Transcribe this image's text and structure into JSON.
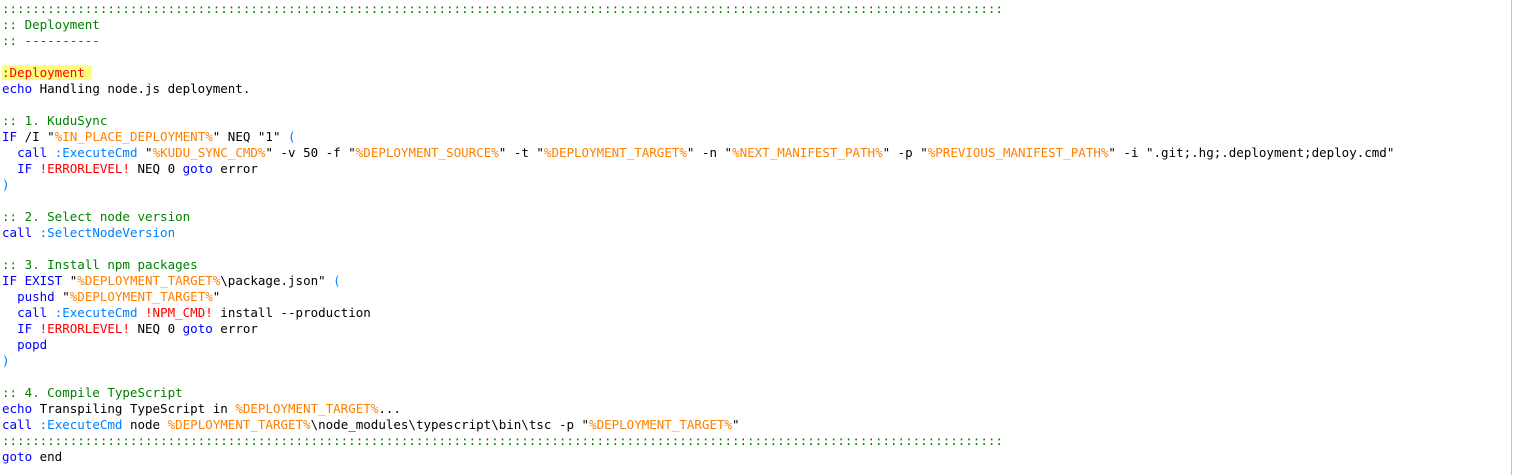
{
  "colors": {
    "comment": "#008000",
    "keyword": "#0000ff",
    "label_fg": "#ff0000",
    "label_bg": "#ffff80",
    "variable": "#ff8000",
    "delayed_variable": "#ff0000",
    "call_target": "#0080ff",
    "text": "#000000"
  },
  "lines": [
    [
      {
        "t": "cmt",
        "v": ":::::::::::::::::::::::::::::::::::::::::::::::::::::::::::::::::::::::::::::::::::::::::::::::::::::::::::::::::::::::::::::::::::::"
      }
    ],
    [
      {
        "t": "cmt",
        "v": ":: Deployment"
      }
    ],
    [
      {
        "t": "cmt",
        "v": ":: ----------"
      }
    ],
    [],
    [
      {
        "t": "lbl",
        "v": ":Deployment "
      }
    ],
    [
      {
        "t": "kw",
        "v": "echo"
      },
      {
        "t": "plain",
        "v": " Handling node.js deployment."
      }
    ],
    [],
    [
      {
        "t": "cmt",
        "v": ":: 1. KuduSync"
      }
    ],
    [
      {
        "t": "kw",
        "v": "IF"
      },
      {
        "t": "plain",
        "v": " /I \""
      },
      {
        "t": "var",
        "v": "%IN_PLACE_DEPLOYMENT%"
      },
      {
        "t": "plain",
        "v": "\" NEQ \"1\" "
      },
      {
        "t": "par",
        "v": "("
      }
    ],
    [
      {
        "t": "plain",
        "v": "  "
      },
      {
        "t": "kw",
        "v": "call"
      },
      {
        "t": "plain",
        "v": " "
      },
      {
        "t": "call",
        "v": ":ExecuteCmd"
      },
      {
        "t": "plain",
        "v": " \""
      },
      {
        "t": "var",
        "v": "%KUDU_SYNC_CMD%"
      },
      {
        "t": "plain",
        "v": "\" -v 50 -f \""
      },
      {
        "t": "var",
        "v": "%DEPLOYMENT_SOURCE%"
      },
      {
        "t": "plain",
        "v": "\" -t \""
      },
      {
        "t": "var",
        "v": "%DEPLOYMENT_TARGET%"
      },
      {
        "t": "plain",
        "v": "\" -n \""
      },
      {
        "t": "var",
        "v": "%NEXT_MANIFEST_PATH%"
      },
      {
        "t": "plain",
        "v": "\" -p \""
      },
      {
        "t": "var",
        "v": "%PREVIOUS_MANIFEST_PATH%"
      },
      {
        "t": "plain",
        "v": "\" -i \".git;.hg;.deployment;deploy.cmd\""
      }
    ],
    [
      {
        "t": "plain",
        "v": "  "
      },
      {
        "t": "kw",
        "v": "IF"
      },
      {
        "t": "plain",
        "v": " "
      },
      {
        "t": "dvar",
        "v": "!ERRORLEVEL!"
      },
      {
        "t": "plain",
        "v": " NEQ 0 "
      },
      {
        "t": "kw",
        "v": "goto"
      },
      {
        "t": "plain",
        "v": " error"
      }
    ],
    [
      {
        "t": "par",
        "v": ")"
      }
    ],
    [],
    [
      {
        "t": "cmt",
        "v": ":: 2. Select node version"
      }
    ],
    [
      {
        "t": "kw",
        "v": "call"
      },
      {
        "t": "plain",
        "v": " "
      },
      {
        "t": "call",
        "v": ":SelectNodeVersion"
      }
    ],
    [],
    [
      {
        "t": "cmt",
        "v": ":: 3. Install npm packages"
      }
    ],
    [
      {
        "t": "kw",
        "v": "IF EXIST"
      },
      {
        "t": "plain",
        "v": " \""
      },
      {
        "t": "var",
        "v": "%DEPLOYMENT_TARGET%"
      },
      {
        "t": "plain",
        "v": "\\package.json\" "
      },
      {
        "t": "par",
        "v": "("
      }
    ],
    [
      {
        "t": "plain",
        "v": "  "
      },
      {
        "t": "kw",
        "v": "pushd"
      },
      {
        "t": "plain",
        "v": " \""
      },
      {
        "t": "var",
        "v": "%DEPLOYMENT_TARGET%"
      },
      {
        "t": "plain",
        "v": "\""
      }
    ],
    [
      {
        "t": "plain",
        "v": "  "
      },
      {
        "t": "kw",
        "v": "call"
      },
      {
        "t": "plain",
        "v": " "
      },
      {
        "t": "call",
        "v": ":ExecuteCmd"
      },
      {
        "t": "plain",
        "v": " "
      },
      {
        "t": "dvar",
        "v": "!NPM_CMD!"
      },
      {
        "t": "plain",
        "v": " install --production"
      }
    ],
    [
      {
        "t": "plain",
        "v": "  "
      },
      {
        "t": "kw",
        "v": "IF"
      },
      {
        "t": "plain",
        "v": " "
      },
      {
        "t": "dvar",
        "v": "!ERRORLEVEL!"
      },
      {
        "t": "plain",
        "v": " NEQ 0 "
      },
      {
        "t": "kw",
        "v": "goto"
      },
      {
        "t": "plain",
        "v": " error"
      }
    ],
    [
      {
        "t": "plain",
        "v": "  "
      },
      {
        "t": "kw",
        "v": "popd"
      }
    ],
    [
      {
        "t": "par",
        "v": ")"
      }
    ],
    [],
    [
      {
        "t": "cmt",
        "v": ":: 4. Compile TypeScript"
      }
    ],
    [
      {
        "t": "kw",
        "v": "echo"
      },
      {
        "t": "plain",
        "v": " Transpiling TypeScript in "
      },
      {
        "t": "var",
        "v": "%DEPLOYMENT_TARGET%"
      },
      {
        "t": "plain",
        "v": "..."
      }
    ],
    [
      {
        "t": "kw",
        "v": "call"
      },
      {
        "t": "plain",
        "v": " "
      },
      {
        "t": "call",
        "v": ":ExecuteCmd"
      },
      {
        "t": "plain",
        "v": " node "
      },
      {
        "t": "var",
        "v": "%DEPLOYMENT_TARGET%"
      },
      {
        "t": "plain",
        "v": "\\node_modules\\typescript\\bin\\tsc -p \""
      },
      {
        "t": "var",
        "v": "%DEPLOYMENT_TARGET%"
      },
      {
        "t": "plain",
        "v": "\""
      }
    ],
    [
      {
        "t": "cmt",
        "v": ":::::::::::::::::::::::::::::::::::::::::::::::::::::::::::::::::::::::::::::::::::::::::::::::::::::::::::::::::::::::::::::::::::::"
      }
    ],
    [
      {
        "t": "kw",
        "v": "goto"
      },
      {
        "t": "plain",
        "v": " end"
      }
    ]
  ]
}
